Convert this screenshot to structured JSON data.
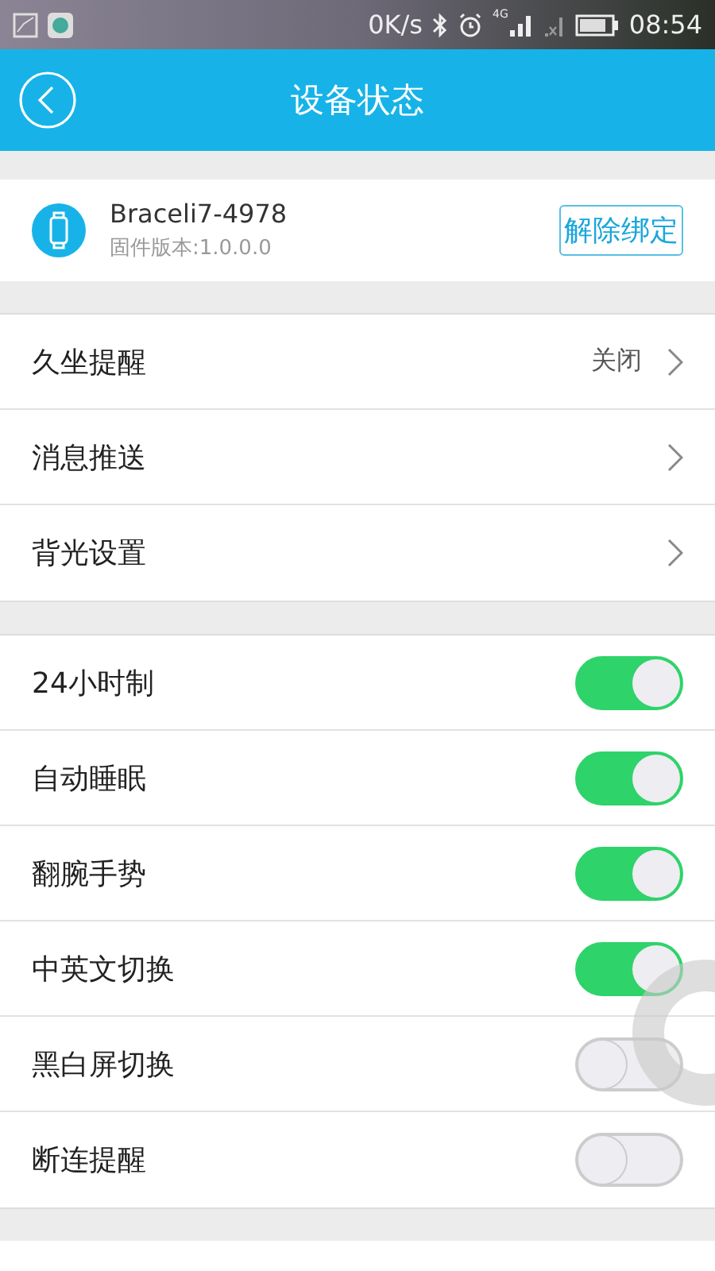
{
  "status_bar": {
    "speed": "0K/s",
    "network": "4G",
    "time": "08:54"
  },
  "header": {
    "title": "设备状态"
  },
  "device": {
    "name": "Braceli7-4978",
    "firmware": "固件版本:1.0.0.0",
    "unbind_button": "解除绑定"
  },
  "menu": [
    {
      "label": "久坐提醒",
      "value": "关闭"
    },
    {
      "label": "消息推送"
    },
    {
      "label": "背光设置"
    }
  ],
  "switches": [
    {
      "label": "24小时制",
      "on": true
    },
    {
      "label": "自动睡眠",
      "on": true
    },
    {
      "label": "翻腕手势",
      "on": true
    },
    {
      "label": "中英文切换",
      "on": true
    },
    {
      "label": "黑白屏切换",
      "on": false
    },
    {
      "label": "断连提醒",
      "on": false
    }
  ]
}
